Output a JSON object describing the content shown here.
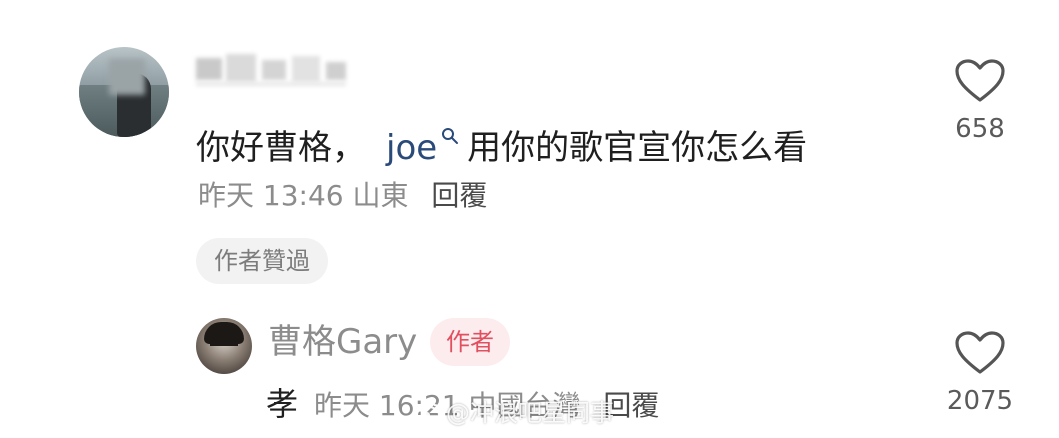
{
  "comment": {
    "text": "你好曹格，",
    "mention": "joe",
    "text_after_mention": "用你的歌官宣你怎么看",
    "time": "昨天 13:46",
    "location": "山東",
    "reply_label": "回覆",
    "author_liked_label": "作者贊過",
    "like_count": "658"
  },
  "reply": {
    "author_name": "曹格Gary",
    "author_badge": "作者",
    "text": "孝",
    "time": "昨天 16:21",
    "location": "中國台灣",
    "reply_label": "回覆",
    "like_count": "2075"
  },
  "watermark": {
    "text": "@冲浪吧星同事"
  },
  "icons": {
    "like": "heart-outline-icon",
    "mention": "search-icon"
  },
  "colors": {
    "text_primary": "#1f1f1f",
    "text_secondary": "#8c8c8c",
    "mention": "#2a4a7a",
    "badge_bg": "#fdecee",
    "badge_text": "#e0505f",
    "chip_bg": "#f2f2f2"
  }
}
